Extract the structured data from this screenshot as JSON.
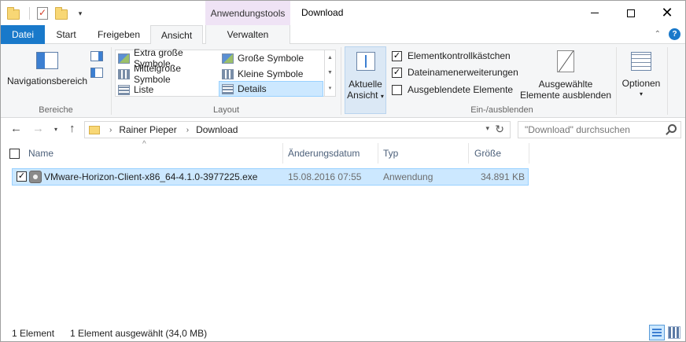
{
  "window": {
    "title": "Download",
    "context_tab_title": "Anwendungstools",
    "controls": [
      "minimize",
      "maximize",
      "close"
    ]
  },
  "quick_access": {
    "icons": [
      "folder-icon",
      "properties-icon",
      "new-folder-icon",
      "customize-dropdown-icon"
    ]
  },
  "tabs": {
    "file": "Datei",
    "start": "Start",
    "share": "Freigeben",
    "view": "Ansicht",
    "manage": "Verwalten",
    "active": "Ansicht"
  },
  "ribbon": {
    "panes": {
      "navigation_pane": "Navigationsbereich",
      "label": "Bereiche"
    },
    "layout": {
      "label": "Layout",
      "items": [
        "Extra große Symbole",
        "Große Symbole",
        "Mittelgroße Symbole",
        "Kleine Symbole",
        "Liste",
        "Details"
      ],
      "selected": "Details"
    },
    "current_view": {
      "line1": "Aktuelle",
      "line2": "Ansicht"
    },
    "show_hide": {
      "label": "Ein-/ausblenden",
      "item_checkboxes": {
        "label": "Elementkontrollkästchen",
        "checked": true
      },
      "file_extensions": {
        "label": "Dateinamenerweiterungen",
        "checked": true
      },
      "hidden_items": {
        "label": "Ausgeblendete Elemente",
        "checked": false
      },
      "hide_selected_line1": "Ausgewählte",
      "hide_selected_line2": "Elemente ausblenden"
    },
    "options": {
      "label": "Optionen"
    }
  },
  "address": {
    "crumbs": [
      "Rainer Pieper",
      "Download"
    ],
    "search_placeholder": "\"Download\" durchsuchen"
  },
  "columns": {
    "name": "Name",
    "date": "Änderungsdatum",
    "type": "Typ",
    "size": "Größe"
  },
  "files": [
    {
      "name": "VMware-Horizon-Client-x86_64-4.1.0-3977225.exe",
      "date": "15.08.2016 07:55",
      "type": "Anwendung",
      "size": "34.891 KB",
      "selected": true,
      "checked": true
    }
  ],
  "status": {
    "count": "1 Element",
    "selection": "1 Element ausgewählt (34,0 MB)"
  },
  "colors": {
    "accent": "#1979ca",
    "selection": "#cce8ff",
    "selection_border": "#99d1ff",
    "context_tab": "#efe3f5",
    "ribbon_bg": "#f5f6f7"
  }
}
